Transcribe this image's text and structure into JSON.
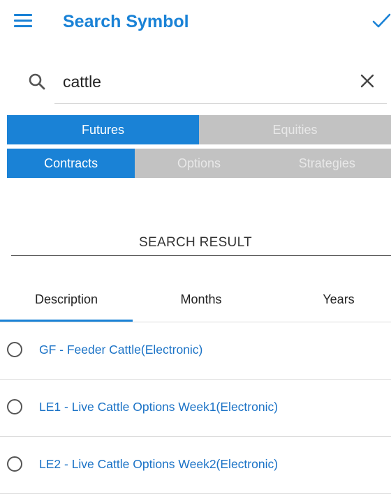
{
  "header": {
    "title": "Search Symbol",
    "menu_icon": "hamburger-menu-icon",
    "confirm_icon": "check-icon",
    "accent_color": "#1a82d6"
  },
  "search": {
    "value": "cattle",
    "placeholder": "",
    "search_icon": "search-icon",
    "clear_icon": "close-icon"
  },
  "asset_tabs": [
    {
      "label": "Futures",
      "active": true
    },
    {
      "label": "Equities",
      "active": false
    }
  ],
  "type_tabs": [
    {
      "label": "Contracts",
      "active": true
    },
    {
      "label": "Options",
      "active": false
    },
    {
      "label": "Strategies",
      "active": false
    }
  ],
  "results": {
    "heading": "SEARCH RESULT",
    "columns": [
      {
        "label": "Description",
        "active": true
      },
      {
        "label": "Months",
        "active": false
      },
      {
        "label": "Years",
        "active": false
      }
    ],
    "items": [
      {
        "label": "GF - Feeder Cattle(Electronic)",
        "selected": false
      },
      {
        "label": "LE1 - Live Cattle Options Week1(Electronic)",
        "selected": false
      },
      {
        "label": "LE2 - Live Cattle Options Week2(Electronic)",
        "selected": false
      }
    ]
  }
}
